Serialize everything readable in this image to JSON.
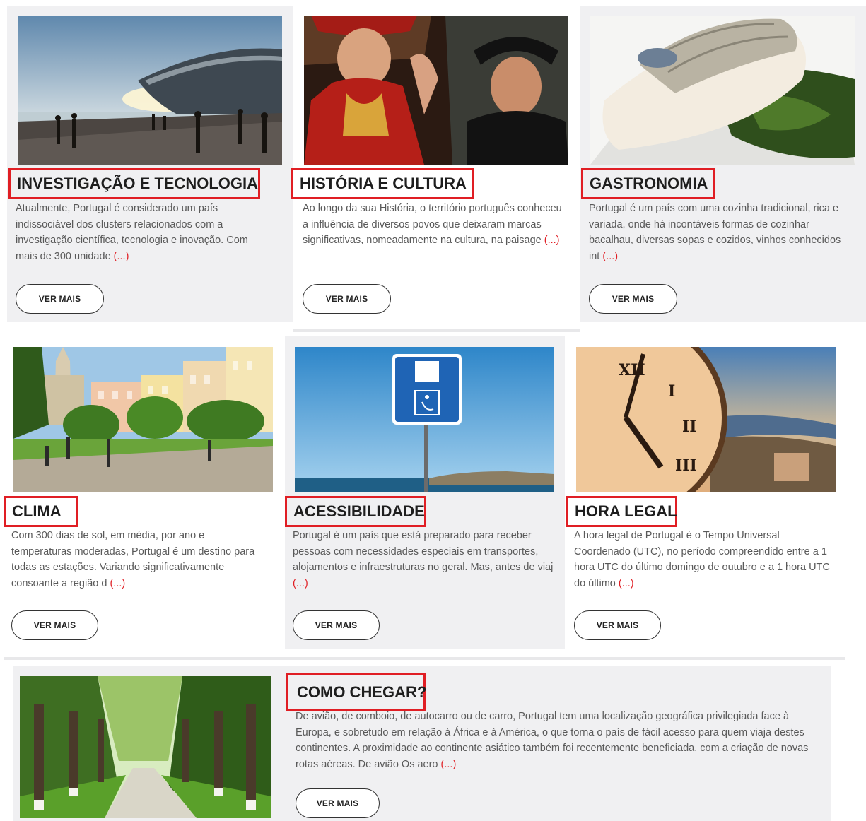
{
  "cards": [
    {
      "title": "INVESTIGAÇÃO E TECNOLOGIA",
      "text": "Atualmente, Portugal é considerado um país indissociável dos clusters relacionados com a investigação científica, tecnologia e inovação. Com mais de 300 unidade",
      "more": "(...)",
      "button": "VER MAIS"
    },
    {
      "title": "HISTÓRIA E CULTURA",
      "text": "Ao longo da sua História, o território português conheceu a influência de diversos povos que deixaram marcas significativas, nomeadamente na cultura, na paisage",
      "more": "(...)",
      "button": "VER MAIS"
    },
    {
      "title": "GASTRONOMIA",
      "text": "Portugal é um país com uma cozinha tradicional, rica e variada, onde há incontáveis formas de cozinhar bacalhau, diversas sopas e cozidos, vinhos conhecidos int",
      "more": "(...)",
      "button": "VER MAIS"
    },
    {
      "title": "CLIMA",
      "text": "Com 300 dias de sol, em média, por ano e temperaturas moderadas, Portugal é um destino para todas as estações. Variando significativamente consoante a região d",
      "more": "(...)",
      "button": "VER MAIS"
    },
    {
      "title": "ACESSIBILIDADE",
      "text": "Portugal é um país que está preparado para receber pessoas com necessidades especiais em transportes, alojamentos e infraestruturas no geral. Mas, antes de viaj",
      "more": "(...)",
      "button": "VER MAIS"
    },
    {
      "title": "HORA LEGAL",
      "text": "A hora legal de Portugal é o Tempo Universal Coordenado (UTC), no período compreendido entre a 1 hora UTC do último domingo de outubro e a 1 hora UTC do último",
      "more": "(...)",
      "button": "VER MAIS"
    },
    {
      "title": "COMO CHEGAR?",
      "text": "De avião, de comboio, de autocarro ou de carro, Portugal tem uma localização geográfica privilegiada face à Europa, e sobretudo em relação à África e à América, o que torna o país de fácil acesso para quem viaja destes continentes. A proximidade ao continente asiático também foi recentemente beneficiada, com a criação de novas rotas aéreas. De avião Os aero",
      "more": "(...)",
      "button": "VER MAIS"
    }
  ],
  "colors": {
    "accent": "#e01e24",
    "card_bg": "#f0f0f2"
  }
}
